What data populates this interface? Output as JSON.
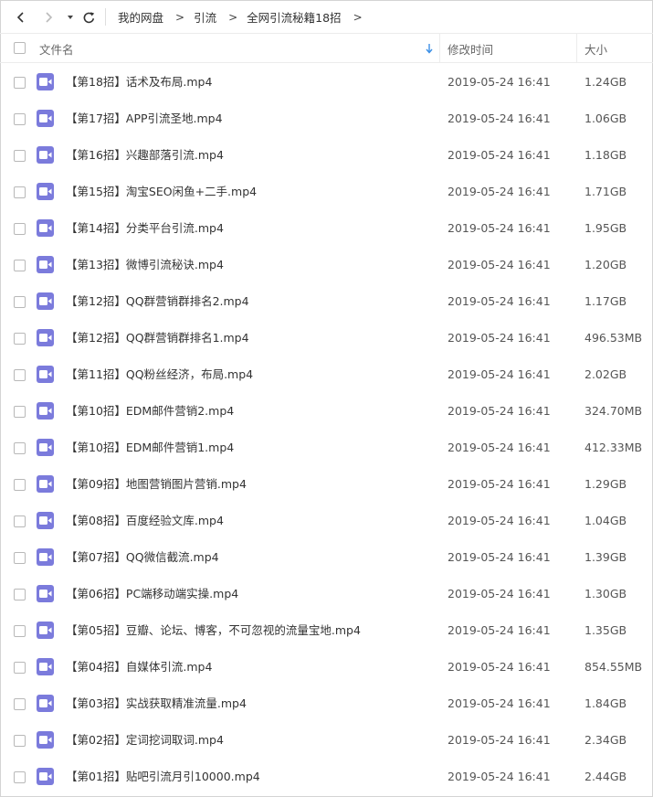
{
  "breadcrumb": [
    "我的网盘",
    "引流",
    "全网引流秘籍18招"
  ],
  "breadcrumb_separator": ">",
  "columns": {
    "name": "文件名",
    "modified": "修改时间",
    "size": "大小"
  },
  "icons": {
    "back": "chevron-left-icon",
    "forward": "chevron-right-icon",
    "history": "caret-down-icon",
    "refresh": "refresh-icon",
    "sort": "sort-down-arrow-icon",
    "file": "video-file-icon"
  },
  "colors": {
    "video_icon": "#7b7bdc",
    "sort_arrow": "#3b8fe6"
  },
  "files": [
    {
      "name": "【第18招】话术及布局.mp4",
      "modified": "2019-05-24 16:41",
      "size": "1.24GB"
    },
    {
      "name": "【第17招】APP引流圣地.mp4",
      "modified": "2019-05-24 16:41",
      "size": "1.06GB"
    },
    {
      "name": "【第16招】兴趣部落引流.mp4",
      "modified": "2019-05-24 16:41",
      "size": "1.18GB"
    },
    {
      "name": "【第15招】淘宝SEO闲鱼+二手.mp4",
      "modified": "2019-05-24 16:41",
      "size": "1.71GB"
    },
    {
      "name": "【第14招】分类平台引流.mp4",
      "modified": "2019-05-24 16:41",
      "size": "1.95GB"
    },
    {
      "name": "【第13招】微博引流秘诀.mp4",
      "modified": "2019-05-24 16:41",
      "size": "1.20GB"
    },
    {
      "name": "【第12招】QQ群营销群排名2.mp4",
      "modified": "2019-05-24 16:41",
      "size": "1.17GB"
    },
    {
      "name": "【第12招】QQ群营销群排名1.mp4",
      "modified": "2019-05-24 16:41",
      "size": "496.53MB"
    },
    {
      "name": "【第11招】QQ粉丝经济，布局.mp4",
      "modified": "2019-05-24 16:41",
      "size": "2.02GB"
    },
    {
      "name": "【第10招】EDM邮件营销2.mp4",
      "modified": "2019-05-24 16:41",
      "size": "324.70MB"
    },
    {
      "name": "【第10招】EDM邮件营销1.mp4",
      "modified": "2019-05-24 16:41",
      "size": "412.33MB"
    },
    {
      "name": "【第09招】地图营销图片营销.mp4",
      "modified": "2019-05-24 16:41",
      "size": "1.29GB"
    },
    {
      "name": "【第08招】百度经验文库.mp4",
      "modified": "2019-05-24 16:41",
      "size": "1.04GB"
    },
    {
      "name": "【第07招】QQ微信截流.mp4",
      "modified": "2019-05-24 16:41",
      "size": "1.39GB"
    },
    {
      "name": "【第06招】PC端移动端实操.mp4",
      "modified": "2019-05-24 16:41",
      "size": "1.30GB"
    },
    {
      "name": "【第05招】豆瓣、论坛、博客，不可忽视的流量宝地.mp4",
      "modified": "2019-05-24 16:41",
      "size": "1.35GB"
    },
    {
      "name": "【第04招】自媒体引流.mp4",
      "modified": "2019-05-24 16:41",
      "size": "854.55MB"
    },
    {
      "name": "【第03招】实战获取精准流量.mp4",
      "modified": "2019-05-24 16:41",
      "size": "1.84GB"
    },
    {
      "name": "【第02招】定词挖词取词.mp4",
      "modified": "2019-05-24 16:41",
      "size": "2.34GB"
    },
    {
      "name": "【第01招】贴吧引流月引10000.mp4",
      "modified": "2019-05-24 16:41",
      "size": "2.44GB"
    }
  ]
}
